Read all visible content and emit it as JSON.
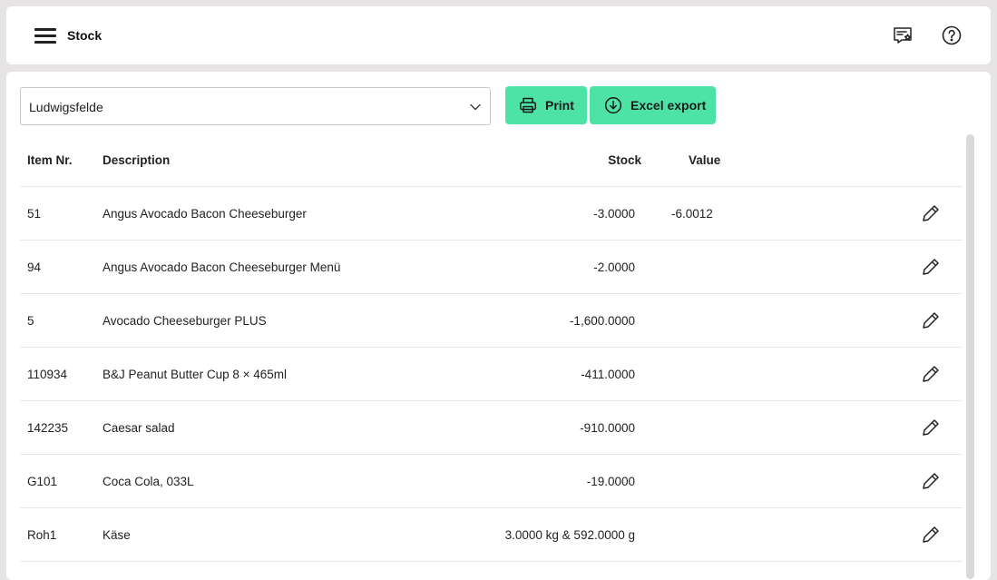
{
  "header": {
    "title": "Stock",
    "menu_icon": "hamburger-menu-icon",
    "feedback_icon": "feedback-star-icon",
    "help_icon": "help-circle-icon"
  },
  "toolbar": {
    "location_value": "Ludwigsfelde",
    "print_label": "Print",
    "excel_label": "Excel export",
    "button_color": "#4de3a5"
  },
  "table": {
    "columns": {
      "item_nr": "Item Nr.",
      "description": "Description",
      "stock": "Stock",
      "value": "Value"
    },
    "rows": [
      {
        "item_nr": "51",
        "description": "Angus Avocado Bacon Cheeseburger",
        "stock": "-3.0000",
        "value": "-6.0012"
      },
      {
        "item_nr": "94",
        "description": "Angus Avocado Bacon Cheeseburger Menü",
        "stock": "-2.0000",
        "value": ""
      },
      {
        "item_nr": "5",
        "description": "Avocado Cheeseburger PLUS",
        "stock": "-1,600.0000",
        "value": ""
      },
      {
        "item_nr": "110934",
        "description": "B&J Peanut Butter Cup 8 × 465ml",
        "stock": "-411.0000",
        "value": ""
      },
      {
        "item_nr": "142235",
        "description": "Caesar salad",
        "stock": "-910.0000",
        "value": ""
      },
      {
        "item_nr": "G101",
        "description": "Coca Cola, 033L",
        "stock": "-19.0000",
        "value": ""
      },
      {
        "item_nr": "Roh1",
        "description": "Käse",
        "stock": "3.0000 kg & 592.0000 g",
        "value": ""
      }
    ]
  }
}
